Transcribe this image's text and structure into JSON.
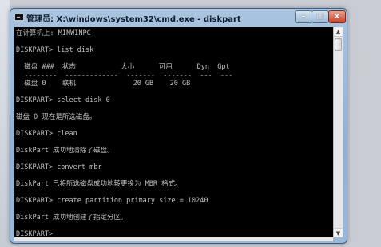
{
  "window": {
    "title": "管理员: X:\\windows\\system32\\cmd.exe - diskpart",
    "controls": {
      "minimize": "–",
      "maximize": "□",
      "close": "x"
    }
  },
  "console": {
    "lines": [
      "在计算机上: MINWINPC",
      "",
      "DISKPART> list disk",
      "",
      "  磁盘 ###  状态           大小      可用      Dyn  Gpt",
      "  --------  -------------  -------  -------  ---  ---",
      "  磁盘 0    联机              20 GB    20 GB",
      "",
      "DISKPART> select disk 0",
      "",
      "磁盘 0 现在是所选磁盘。",
      "",
      "DISKPART> clean",
      "",
      "DiskPart 成功地清除了磁盘。",
      "",
      "DISKPART> convert mbr",
      "",
      "DiskPart 已将所选磁盘成功地转更换为 MBR 格式。",
      "",
      "DISKPART> create partition primary size = 10240",
      "",
      "DiskPart 成功地创建了指定分区。",
      "",
      "DISKPART>"
    ]
  },
  "colors": {
    "console_background": "#000000",
    "console_text": "#c0c0c0",
    "window_frame": "#8fb0d3"
  },
  "icons": {
    "app": "cmd-icon",
    "scroll_up": "arrow-up-icon",
    "scroll_down": "arrow-down-icon"
  }
}
